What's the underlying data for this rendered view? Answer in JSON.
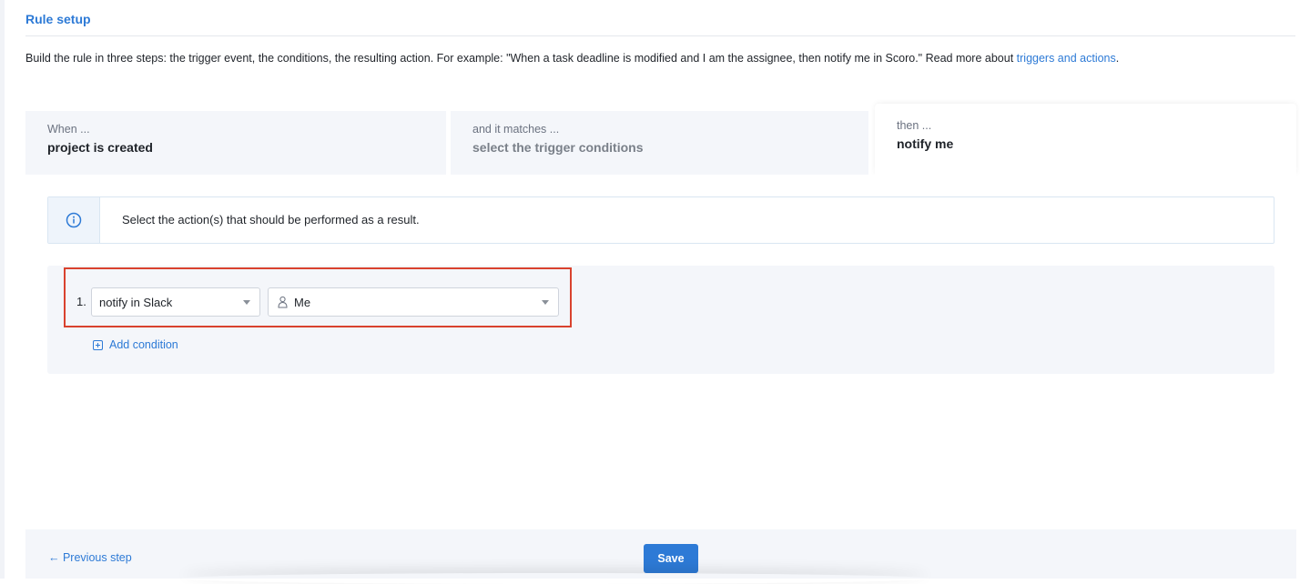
{
  "section": {
    "title": "Rule setup",
    "description_prefix": "Build the rule in three steps: the trigger event, the conditions, the resulting action. For example: \"When a task deadline is modified and I am the assignee, then notify me in Scoro.\" Read more about ",
    "description_link": "triggers and actions",
    "description_suffix": "."
  },
  "steps": [
    {
      "kicker": "When ...",
      "value": "project is created"
    },
    {
      "kicker": "and it matches ...",
      "value": "select the trigger conditions"
    },
    {
      "kicker": "then ...",
      "value": "notify me"
    }
  ],
  "info": {
    "icon": "info-icon",
    "text": "Select the action(s) that should be performed as a result."
  },
  "action_row": {
    "number": "1.",
    "action_value": "notify in Slack",
    "recipient_icon": "user-icon",
    "recipient_value": "Me"
  },
  "add_condition_label": "Add condition",
  "footer": {
    "previous_label": "← Previous step",
    "save_label": "Save"
  },
  "colors": {
    "accent": "#2d7ad6",
    "highlight": "#d9422e",
    "panel_bg": "#f4f6fa"
  }
}
